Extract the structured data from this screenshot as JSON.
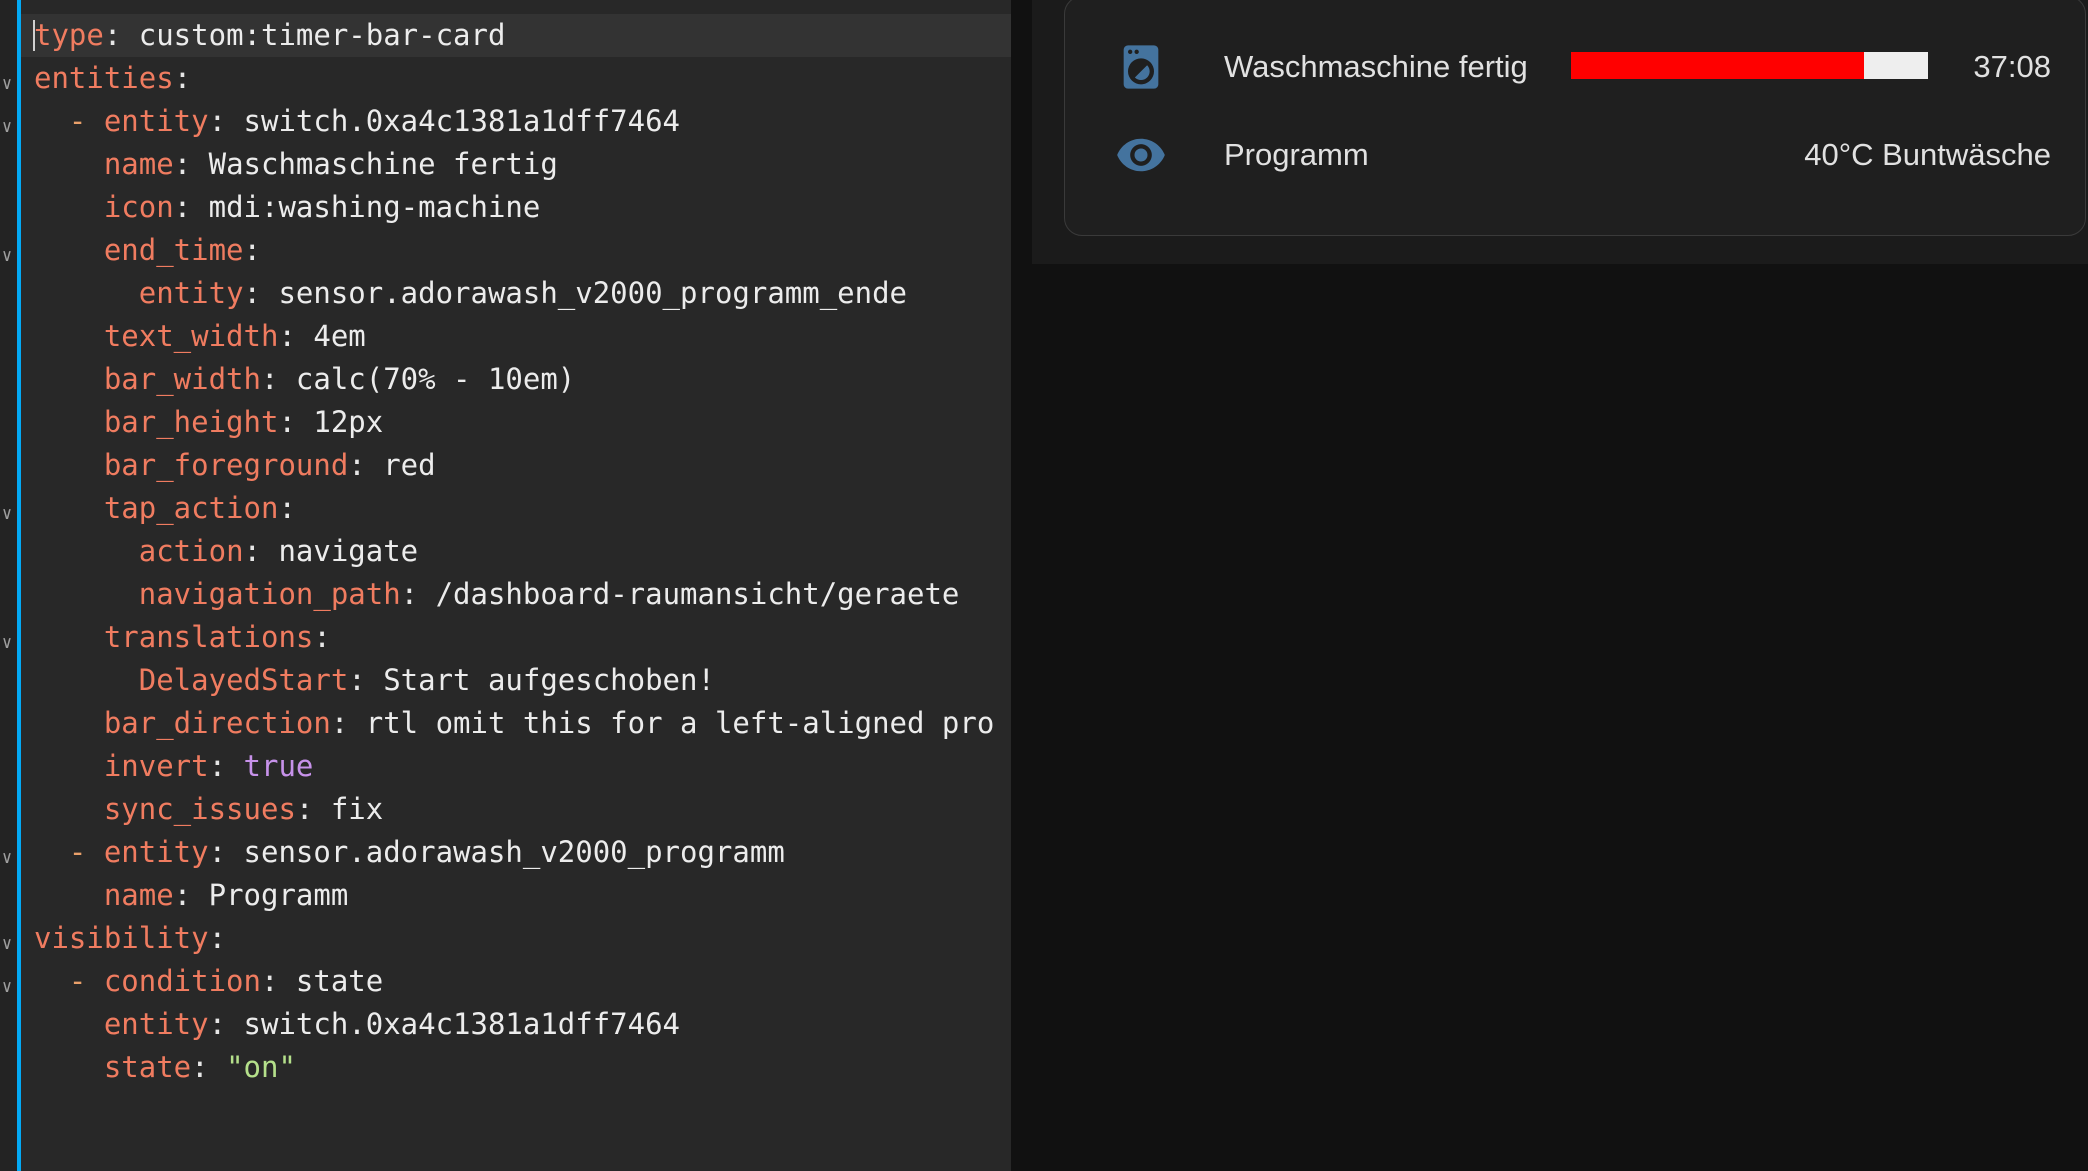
{
  "editor": {
    "lines": [
      {
        "indent": "",
        "dash": "",
        "key": "type",
        "value": "custom:timer-bar-card",
        "value_kind": "plain",
        "fold": false,
        "active": true
      },
      {
        "indent": "",
        "dash": "",
        "key": "entities",
        "value": "",
        "value_kind": "plain",
        "fold": true,
        "active": false
      },
      {
        "indent": "  ",
        "dash": "- ",
        "key": "entity",
        "value": "switch.0xa4c1381a1dff7464",
        "value_kind": "plain",
        "fold": true,
        "active": false
      },
      {
        "indent": "    ",
        "dash": "",
        "key": "name",
        "value": "Waschmaschine fertig",
        "value_kind": "plain",
        "fold": false,
        "active": false
      },
      {
        "indent": "    ",
        "dash": "",
        "key": "icon",
        "value": "mdi:washing-machine",
        "value_kind": "plain",
        "fold": false,
        "active": false
      },
      {
        "indent": "    ",
        "dash": "",
        "key": "end_time",
        "value": "",
        "value_kind": "plain",
        "fold": true,
        "active": false
      },
      {
        "indent": "      ",
        "dash": "",
        "key": "entity",
        "value": "sensor.adorawash_v2000_programm_ende",
        "value_kind": "plain",
        "fold": false,
        "active": false
      },
      {
        "indent": "    ",
        "dash": "",
        "key": "text_width",
        "value": "4em",
        "value_kind": "plain",
        "fold": false,
        "active": false
      },
      {
        "indent": "    ",
        "dash": "",
        "key": "bar_width",
        "value": "calc(70% - 10em)",
        "value_kind": "plain",
        "fold": false,
        "active": false
      },
      {
        "indent": "    ",
        "dash": "",
        "key": "bar_height",
        "value": "12px",
        "value_kind": "plain",
        "fold": false,
        "active": false
      },
      {
        "indent": "    ",
        "dash": "",
        "key": "bar_foreground",
        "value": "red",
        "value_kind": "plain",
        "fold": false,
        "active": false
      },
      {
        "indent": "    ",
        "dash": "",
        "key": "tap_action",
        "value": "",
        "value_kind": "plain",
        "fold": true,
        "active": false
      },
      {
        "indent": "      ",
        "dash": "",
        "key": "action",
        "value": "navigate",
        "value_kind": "plain",
        "fold": false,
        "active": false
      },
      {
        "indent": "      ",
        "dash": "",
        "key": "navigation_path",
        "value": "/dashboard-raumansicht/geraete",
        "value_kind": "plain",
        "fold": false,
        "active": false
      },
      {
        "indent": "    ",
        "dash": "",
        "key": "translations",
        "value": "",
        "value_kind": "plain",
        "fold": true,
        "active": false
      },
      {
        "indent": "      ",
        "dash": "",
        "key": "DelayedStart",
        "value": "Start aufgeschoben!",
        "value_kind": "plain",
        "fold": false,
        "active": false
      },
      {
        "indent": "    ",
        "dash": "",
        "key": "bar_direction",
        "value": "rtl omit this for a left-aligned pro",
        "value_kind": "plain",
        "fold": false,
        "active": false
      },
      {
        "indent": "    ",
        "dash": "",
        "key": "invert",
        "value": "true",
        "value_kind": "bool",
        "fold": false,
        "active": false
      },
      {
        "indent": "    ",
        "dash": "",
        "key": "sync_issues",
        "value": "fix",
        "value_kind": "plain",
        "fold": false,
        "active": false
      },
      {
        "indent": "  ",
        "dash": "- ",
        "key": "entity",
        "value": "sensor.adorawash_v2000_programm",
        "value_kind": "plain",
        "fold": true,
        "active": false
      },
      {
        "indent": "    ",
        "dash": "",
        "key": "name",
        "value": "Programm",
        "value_kind": "plain",
        "fold": false,
        "active": false
      },
      {
        "indent": "",
        "dash": "",
        "key": "visibility",
        "value": "",
        "value_kind": "plain",
        "fold": true,
        "active": false
      },
      {
        "indent": "  ",
        "dash": "- ",
        "key": "condition",
        "value": "state",
        "value_kind": "plain",
        "fold": true,
        "active": false
      },
      {
        "indent": "    ",
        "dash": "",
        "key": "entity",
        "value": "switch.0xa4c1381a1dff7464",
        "value_kind": "plain",
        "fold": false,
        "active": false
      },
      {
        "indent": "    ",
        "dash": "",
        "key": "state",
        "value": "\"on\"",
        "value_kind": "str",
        "fold": false,
        "active": false
      }
    ]
  },
  "preview": {
    "rows": [
      {
        "icon": "washing-machine-icon",
        "name": "Waschmaschine fertig",
        "value": "37:08",
        "bar_fraction": 0.82,
        "bar_color": "#ff0000",
        "bar_track_color": "#eeeeee"
      },
      {
        "icon": "eye-icon",
        "name": "Programm",
        "value": "40°C Buntwäsche"
      }
    ]
  },
  "colors": {
    "accent": "#03a9f4",
    "icon": "#44739e"
  }
}
